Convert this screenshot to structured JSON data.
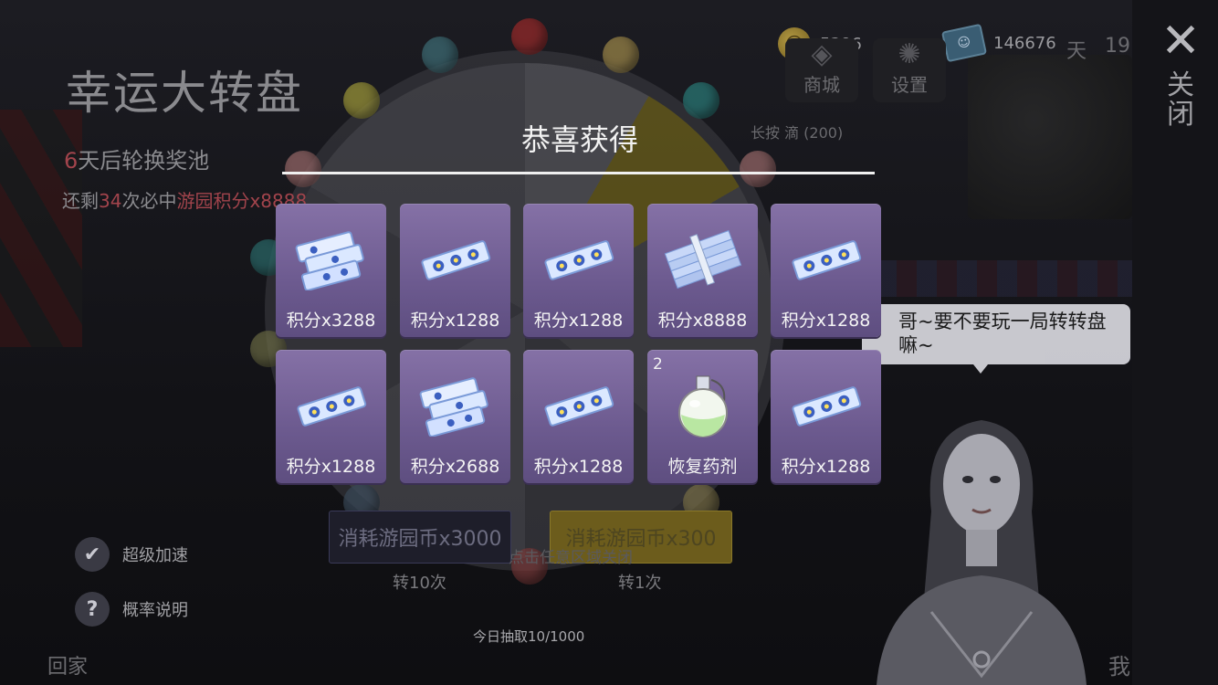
{
  "scene": {
    "title": "幸运大转盘",
    "rotate": {
      "num": "6",
      "text": "天后轮换奖池"
    },
    "remain": {
      "pre": "还剩",
      "num": "34",
      "mid": "次必中",
      "highlight": "游园积分x8888"
    },
    "currency": [
      {
        "icon": "coin-icon",
        "value": "5296"
      },
      {
        "icon": "ticket-icon",
        "value": "146676"
      }
    ],
    "menu": [
      {
        "label": "商城",
        "icon": "shop-icon"
      },
      {
        "label": "设置",
        "icon": "gear-icon"
      }
    ],
    "menu_extra": {
      "caption": "长按 滴 (200)",
      "day": "天",
      "day_num": "19"
    },
    "close": {
      "icon": "close-icon",
      "label": "关闭"
    },
    "options": [
      {
        "icon": "check-icon",
        "label": "超级加速"
      },
      {
        "icon": "question-icon",
        "label": "概率说明"
      }
    ],
    "spin_buttons": [
      {
        "label": "消耗游园币x3000",
        "sub": "转10次"
      },
      {
        "label": "消耗游园币x300",
        "sub": "转1次"
      }
    ],
    "today_draw": "今日抽取10/1000",
    "tap_close": "点击任意区域关闭",
    "home_label": "回家",
    "me_label": "我",
    "bubble_text": "哥~要不要玩一局转转盘嘛~",
    "colors": {
      "accent_red": "#a2444c",
      "gold_button": "#6c5c1c",
      "card_purple": "#7a66a0"
    }
  },
  "modal": {
    "title": "恭喜获得",
    "rewards": [
      {
        "icon": "ticket-pile-icon",
        "label": "积分x3288",
        "qty": ""
      },
      {
        "icon": "ticket-strip-icon",
        "label": "积分x1288",
        "qty": ""
      },
      {
        "icon": "ticket-strip-icon",
        "label": "积分x1288",
        "qty": ""
      },
      {
        "icon": "ticket-bundle-icon",
        "label": "积分x8888",
        "qty": ""
      },
      {
        "icon": "ticket-strip-icon",
        "label": "积分x1288",
        "qty": ""
      },
      {
        "icon": "ticket-strip-icon",
        "label": "积分x1288",
        "qty": ""
      },
      {
        "icon": "ticket-pile-icon",
        "label": "积分x2688",
        "qty": ""
      },
      {
        "icon": "ticket-strip-icon",
        "label": "积分x1288",
        "qty": ""
      },
      {
        "icon": "potion-icon",
        "label": "恢复药剂",
        "qty": "2"
      },
      {
        "icon": "ticket-strip-icon",
        "label": "积分x1288",
        "qty": ""
      }
    ]
  }
}
